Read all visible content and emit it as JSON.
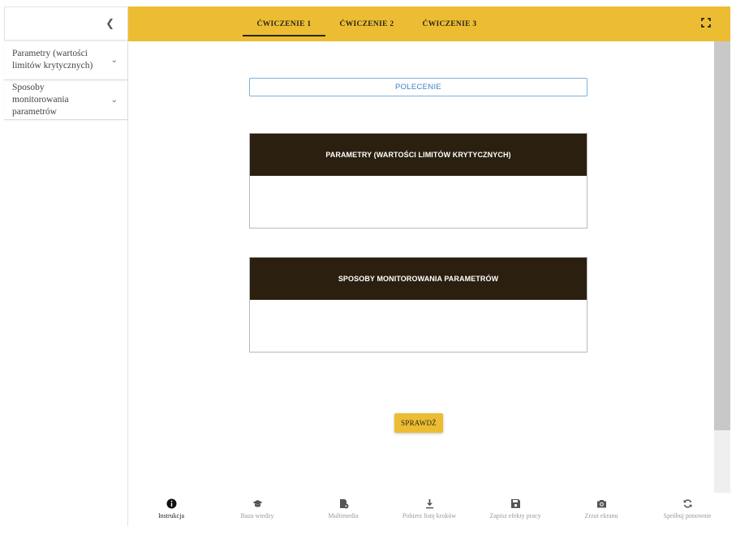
{
  "sidebar": {
    "collapse_icon": "chevron-left-icon",
    "items": [
      {
        "label": "Parametry (wartości limitów krytycznych)"
      },
      {
        "label": "Sposoby monitorowania parametrów"
      }
    ]
  },
  "tabs": [
    {
      "label": "ĆWICZENIE 1",
      "active": true
    },
    {
      "label": "ĆWICZENIE 2",
      "active": false
    },
    {
      "label": "ĆWICZENIE 3",
      "active": false
    }
  ],
  "main": {
    "polecenie_label": "POLECENIE",
    "panels": [
      {
        "title": "PARAMETRY (WARTOŚCI LIMITÓW KRYTYCZNYCH)"
      },
      {
        "title": "SPOSOBY MONITOROWANIA PARAMETRÓW"
      }
    ],
    "check_label": "SPRAWDŹ"
  },
  "toolbar": [
    {
      "label": "Instrukcja",
      "icon": "info-icon",
      "active": true
    },
    {
      "label": "Baza wiedzy",
      "icon": "graduation-cap-icon",
      "active": false
    },
    {
      "label": "Multimedia",
      "icon": "multimedia-icon",
      "active": false
    },
    {
      "label": "Pobierz listę kroków",
      "icon": "download-icon",
      "active": false
    },
    {
      "label": "Zapisz efekty pracy",
      "icon": "save-icon",
      "active": false
    },
    {
      "label": "Zrzut ekranu",
      "icon": "camera-icon",
      "active": false
    },
    {
      "label": "Spróbuj ponownie",
      "icon": "refresh-icon",
      "active": false
    }
  ],
  "colors": {
    "accent": "#ecbd32",
    "panel_header": "#2b2010",
    "polecenie_text": "#3b82c4"
  }
}
